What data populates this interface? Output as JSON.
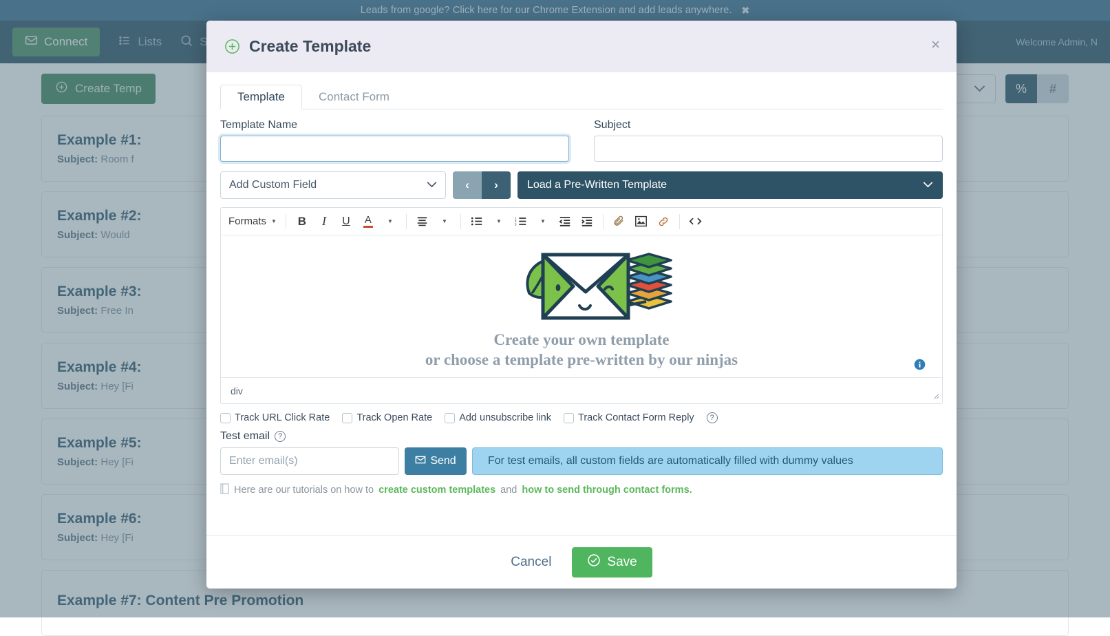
{
  "promo": {
    "text": "Leads from google? Click here for our Chrome Extension and add leads anywhere.",
    "close": "✖"
  },
  "navbar": {
    "connect_label": "Connect",
    "lists_label": "Lists",
    "search_label": "S",
    "welcome": "Welcome Admin, N"
  },
  "page": {
    "create_template_label": "Create Temp",
    "filter_value": "",
    "toggle_percent": "%",
    "toggle_hash": "#",
    "subject_prefix": "Subject:",
    "templates": [
      {
        "title": "Example #1:",
        "subject": "Room f"
      },
      {
        "title": "Example #2:",
        "subject": "Would"
      },
      {
        "title": "Example #3:",
        "subject": "Free In"
      },
      {
        "title": "Example #4:",
        "subject": "Hey [Fi"
      },
      {
        "title": "Example #5:",
        "subject": "Hey [Fi"
      },
      {
        "title": "Example #6:",
        "subject": "Hey [Fi"
      },
      {
        "title": "Example #7: Content Pre Promotion",
        "subject": ""
      }
    ]
  },
  "modal": {
    "title": "Create Template",
    "close": "×",
    "tabs": [
      {
        "label": "Template",
        "active": true
      },
      {
        "label": "Contact Form",
        "active": false
      }
    ],
    "template_name": {
      "label": "Template Name",
      "value": "",
      "placeholder": ""
    },
    "subject": {
      "label": "Subject",
      "value": "",
      "placeholder": ""
    },
    "custom_field_select": "Add Custom Field",
    "prev_arrow": "‹",
    "next_arrow": "›",
    "prewritten_select": "Load a Pre-Written Template",
    "editor": {
      "formats_label": "Formats",
      "toolbar_icons": [
        "bold-icon",
        "italic-icon",
        "underline-icon",
        "text-color-icon",
        "align-left-icon",
        "bullet-list-icon",
        "numbered-list-icon",
        "outdent-icon",
        "indent-icon",
        "attach-icon",
        "image-icon",
        "link-icon",
        "source-code-icon"
      ],
      "placeholder_line1": "Create your own template",
      "placeholder_line2": "or choose a template pre-written by our ninjas",
      "status_path": "div"
    },
    "checkboxes": [
      {
        "label": "Track URL Click Rate",
        "checked": false
      },
      {
        "label": "Track Open Rate",
        "checked": false
      },
      {
        "label": "Add unsubscribe link",
        "checked": false
      },
      {
        "label": "Track Contact Form Reply",
        "checked": false
      }
    ],
    "help_glyph": "?",
    "test_email": {
      "label": "Test email",
      "placeholder": "Enter email(s)",
      "value": "",
      "send_label": "Send",
      "alert": "For test emails, all custom fields are automatically filled with dummy values"
    },
    "tutorial": {
      "prefix": "Here are our tutorials on how to",
      "link1": "create custom templates",
      "middle": "and",
      "link2": "how to send through contact forms."
    },
    "footer": {
      "cancel_label": "Cancel",
      "save_label": "Save"
    }
  },
  "colors": {
    "brand_green": "#4fb55e",
    "navy": "#1b4559",
    "header_lavender": "#ecebf3",
    "info_blue": "#9ed4f0",
    "link_green": "#5cb85c"
  }
}
